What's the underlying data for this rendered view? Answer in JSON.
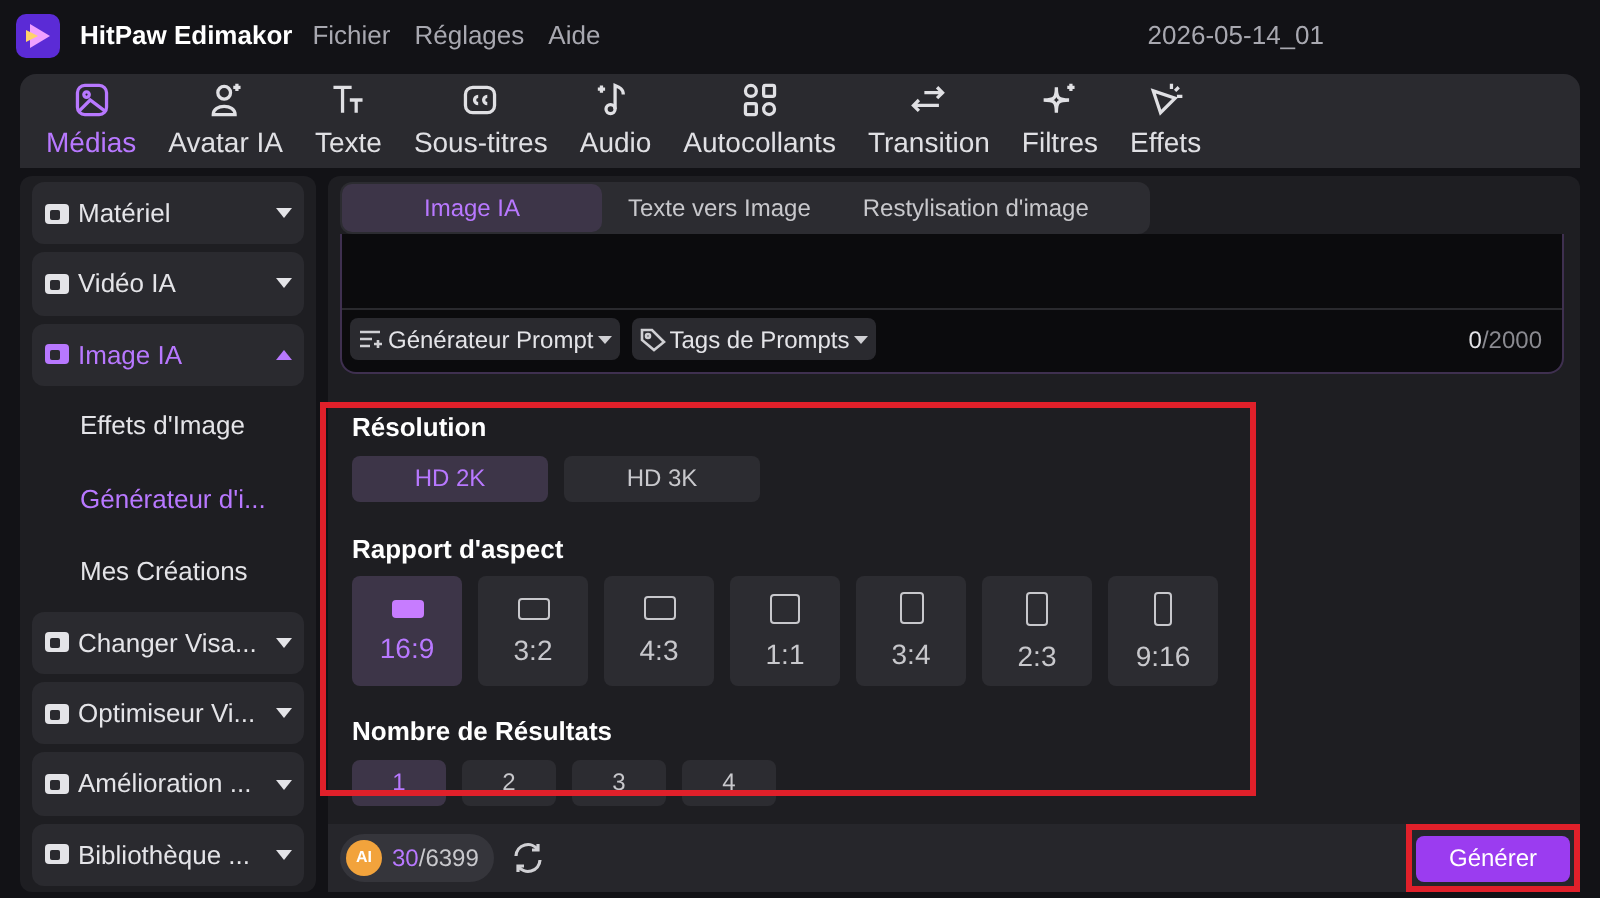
{
  "app": {
    "name": "HitPaw Edimakor",
    "menu": [
      "Fichier",
      "Réglages",
      "Aide"
    ],
    "project": "2026-05-14_01"
  },
  "toolbar": [
    {
      "label": "Médias",
      "selected": true
    },
    {
      "label": "Avatar IA",
      "selected": false
    },
    {
      "label": "Texte",
      "selected": false
    },
    {
      "label": "Sous-titres",
      "selected": false
    },
    {
      "label": "Audio",
      "selected": false
    },
    {
      "label": "Autocollants",
      "selected": false
    },
    {
      "label": "Transition",
      "selected": false
    },
    {
      "label": "Filtres",
      "selected": false
    },
    {
      "label": "Effets",
      "selected": false
    }
  ],
  "sidebar": [
    {
      "label": "Matériel",
      "expanded": false,
      "selected": false
    },
    {
      "label": "Vidéo IA",
      "expanded": false,
      "selected": false
    },
    {
      "label": "Image IA",
      "expanded": true,
      "selected": true,
      "children": [
        {
          "label": "Effets d'Image",
          "selected": false
        },
        {
          "label": "Générateur d'i...",
          "selected": true
        },
        {
          "label": "Mes Créations",
          "selected": false
        }
      ]
    },
    {
      "label": "Changer Visa...",
      "expanded": false,
      "selected": false
    },
    {
      "label": "Optimiseur Vi...",
      "expanded": false,
      "selected": false
    },
    {
      "label": "Amélioration ...",
      "expanded": false,
      "selected": false
    },
    {
      "label": "Bibliothèque ...",
      "expanded": false,
      "selected": false
    }
  ],
  "tabs": [
    {
      "label": "Image IA",
      "selected": true
    },
    {
      "label": "Texte vers Image",
      "selected": false
    },
    {
      "label": "Restylisation d'image",
      "selected": false
    }
  ],
  "prompt": {
    "buttons": [
      "Générateur Prompt",
      "Tags de Prompts"
    ],
    "count": "0",
    "limit": "/2000"
  },
  "resolution": {
    "title": "Résolution",
    "options": [
      {
        "label": "HD 2K",
        "selected": true
      },
      {
        "label": "HD 3K",
        "selected": false
      }
    ]
  },
  "aspect": {
    "title": "Rapport d'aspect",
    "options": [
      {
        "label": "16:9",
        "selected": true
      },
      {
        "label": "3:2",
        "selected": false
      },
      {
        "label": "4:3",
        "selected": false
      },
      {
        "label": "1:1",
        "selected": false
      },
      {
        "label": "3:4",
        "selected": false
      },
      {
        "label": "2:3",
        "selected": false
      },
      {
        "label": "9:16",
        "selected": false
      }
    ]
  },
  "results": {
    "title": "Nombre de Résultats",
    "options": [
      {
        "label": "1",
        "selected": true
      },
      {
        "label": "2",
        "selected": false
      },
      {
        "label": "3",
        "selected": false
      },
      {
        "label": "4",
        "selected": false
      }
    ]
  },
  "credits": {
    "badge": "AI",
    "used": "30",
    "total": "/6399"
  },
  "generate": "Générer"
}
